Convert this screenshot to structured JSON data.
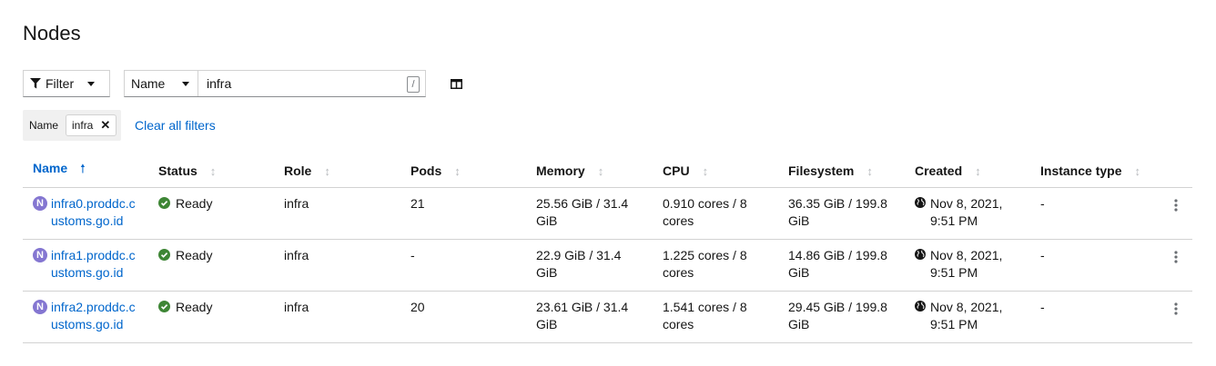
{
  "page": {
    "title": "Nodes"
  },
  "toolbar": {
    "filter_label": "Filter",
    "search_attribute": "Name",
    "search_value": "infra",
    "search_shortcut": "/"
  },
  "chips": {
    "category": "Name",
    "value": "infra",
    "clear_all": "Clear all filters"
  },
  "table": {
    "columns": [
      "Name",
      "Status",
      "Role",
      "Pods",
      "Memory",
      "CPU",
      "Filesystem",
      "Created",
      "Instance type"
    ],
    "rows": [
      {
        "badge": "N",
        "name": "infra0.proddc.customs.go.id",
        "status": "Ready",
        "role": "infra",
        "pods": "21",
        "memory": "25.56 GiB / 31.4 GiB",
        "cpu": "0.910 cores / 8 cores",
        "filesystem": "36.35 GiB / 199.8 GiB",
        "created": "Nov 8, 2021, 9:51 PM",
        "instance_type": "-"
      },
      {
        "badge": "N",
        "name": "infra1.proddc.customs.go.id",
        "status": "Ready",
        "role": "infra",
        "pods": "-",
        "memory": "22.9 GiB / 31.4 GiB",
        "cpu": "1.225 cores / 8 cores",
        "filesystem": "14.86 GiB / 199.8 GiB",
        "created": "Nov 8, 2021, 9:51 PM",
        "instance_type": "-"
      },
      {
        "badge": "N",
        "name": "infra2.proddc.customs.go.id",
        "status": "Ready",
        "role": "infra",
        "pods": "20",
        "memory": "23.61 GiB / 31.4 GiB",
        "cpu": "1.541 cores / 8 cores",
        "filesystem": "29.45 GiB / 199.8 GiB",
        "created": "Nov 8, 2021, 9:51 PM",
        "instance_type": "-"
      }
    ]
  },
  "colors": {
    "link": "#0066cc",
    "success": "#3e8635",
    "node_badge": "#8476d1"
  },
  "icons": {
    "filter": "filter-icon",
    "columns": "columns-icon",
    "sort_asc": "arrow-up-icon",
    "sort": "sort-icon",
    "ready": "check-circle-icon",
    "created": "globe-icon",
    "row_actions": "kebab-icon"
  }
}
